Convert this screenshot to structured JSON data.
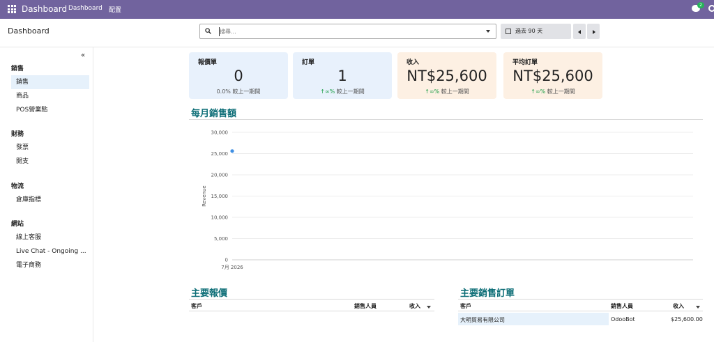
{
  "topbar": {
    "app": "Dashboard",
    "menu": [
      "Dashboard",
      "配置"
    ],
    "chat_count": "2",
    "brand_color": "#71639e"
  },
  "control": {
    "title": "Dashboard",
    "search_placeholder": "搜尋...",
    "period": "過去 90 天"
  },
  "sidebar": {
    "collapse": "«",
    "sections": [
      {
        "name": "銷售",
        "items": [
          "銷售",
          "商品",
          "POS營業點"
        ]
      },
      {
        "name": "財務",
        "items": [
          "發票",
          "開支"
        ]
      },
      {
        "name": "物流",
        "items": [
          "倉庫指標"
        ]
      },
      {
        "name": "網站",
        "items": [
          "線上客服",
          "Live Chat - Ongoing ...",
          "電子商務"
        ]
      }
    ]
  },
  "kpis": [
    {
      "title": "報價單",
      "value": "0",
      "pct": "0.0%",
      "change": "較上一期間"
    },
    {
      "title": "訂單",
      "value": "1",
      "pct": "↑∞%",
      "change": "較上一期間"
    },
    {
      "title": "收入",
      "value": "NT$25,600",
      "pct": "↑∞%",
      "change": "較上一期間"
    },
    {
      "title": "平均訂單",
      "value": "NT$25,600",
      "pct": "↑∞%",
      "change": "較上一期間"
    }
  ],
  "monthly": {
    "title": "每月銷售額"
  },
  "chart_data": {
    "type": "line",
    "ylabel": "Revenue",
    "ylim": [
      0,
      30000
    ],
    "yticks": [
      0,
      5000,
      10000,
      15000,
      20000,
      25000,
      30000
    ],
    "ytick_labels": [
      "0",
      "5,000",
      "10,000",
      "15,000",
      "20,000",
      "25,000",
      "30,000"
    ],
    "categories": [
      "7月 2026"
    ],
    "series": [
      {
        "values": [
          25600
        ]
      }
    ],
    "point_color": "#3f8fe3",
    "grid": true
  },
  "quotes": {
    "title": "主要報價",
    "columns": [
      "客戶",
      "銷售人員",
      "收入"
    ]
  },
  "orders": {
    "title": "主要銷售訂單",
    "columns": [
      "客戶",
      "銷售人員",
      "收入"
    ],
    "rows": [
      {
        "customer": "大明貿易有限公司",
        "salesperson": "OdooBot",
        "revenue": "$25,600.00"
      }
    ]
  }
}
